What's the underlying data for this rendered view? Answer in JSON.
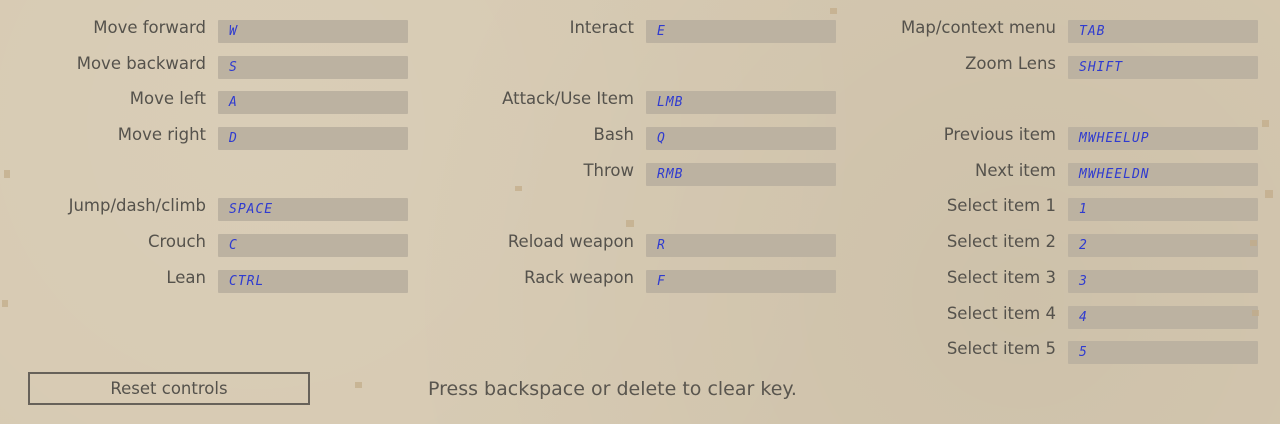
{
  "columns": {
    "left": [
      {
        "label": "Move forward",
        "key": "W"
      },
      {
        "label": "Move backward",
        "key": "S"
      },
      {
        "label": "Move left",
        "key": "A"
      },
      {
        "label": "Move right",
        "key": "D"
      },
      null,
      {
        "label": "Jump/dash/climb",
        "key": "SPACE"
      },
      {
        "label": "Crouch",
        "key": "C"
      },
      {
        "label": "Lean",
        "key": "CTRL"
      }
    ],
    "middle": [
      {
        "label": "Interact",
        "key": "E"
      },
      null,
      {
        "label": "Attack/Use Item",
        "key": "LMB"
      },
      {
        "label": "Bash",
        "key": "Q"
      },
      {
        "label": "Throw",
        "key": "RMB"
      },
      null,
      {
        "label": "Reload weapon",
        "key": "R"
      },
      {
        "label": "Rack weapon",
        "key": "F"
      }
    ],
    "right": [
      {
        "label": "Map/context menu",
        "key": "TAB"
      },
      {
        "label": "Zoom Lens",
        "key": "SHIFT"
      },
      null,
      {
        "label": "Previous item",
        "key": "MWHEELUP"
      },
      {
        "label": "Next item",
        "key": "MWHEELDN"
      },
      {
        "label": "Select item 1",
        "key": "1"
      },
      {
        "label": "Select item 2",
        "key": "2"
      },
      {
        "label": "Select item 3",
        "key": "3"
      },
      {
        "label": "Select item 4",
        "key": "4"
      },
      {
        "label": "Select item 5",
        "key": "5"
      }
    ]
  },
  "footer": {
    "reset_label": "Reset controls",
    "hint": "Press backspace or delete to clear key."
  },
  "colors": {
    "background": "#d6c9b1",
    "field": "#bcb2a1",
    "key_text": "#2f3bd0",
    "label_text": "#55524c"
  }
}
